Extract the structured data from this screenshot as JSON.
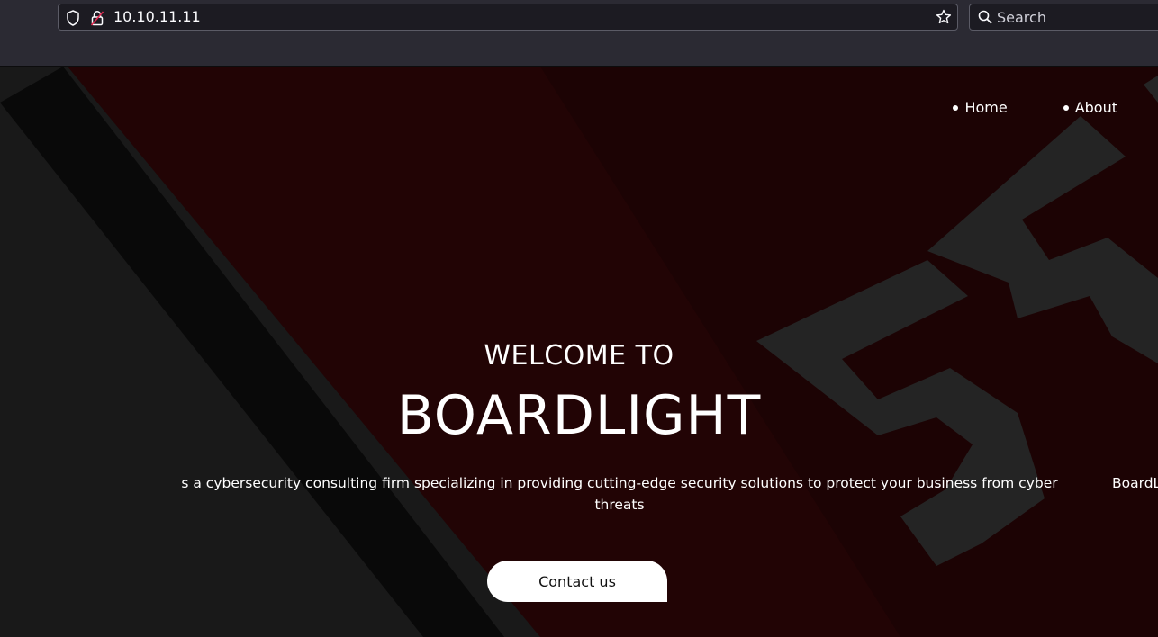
{
  "browser": {
    "url": "10.10.11.11",
    "search_placeholder": "Search"
  },
  "nav": {
    "items": [
      {
        "label": "Home"
      },
      {
        "label": "About"
      }
    ]
  },
  "hero": {
    "welcome": "WELCOME TO",
    "title": "BOARDLIGHT",
    "tagline": "s a cybersecurity consulting firm specializing in providing cutting-edge security solutions to protect your business from cyber threats",
    "tagline_next": "BoardL",
    "cta_label": "Contact us"
  },
  "colors": {
    "chrome": "#2b2a33",
    "field": "#1c1b22",
    "accent_red": "#2b0508",
    "button_bg": "#ffffff"
  }
}
